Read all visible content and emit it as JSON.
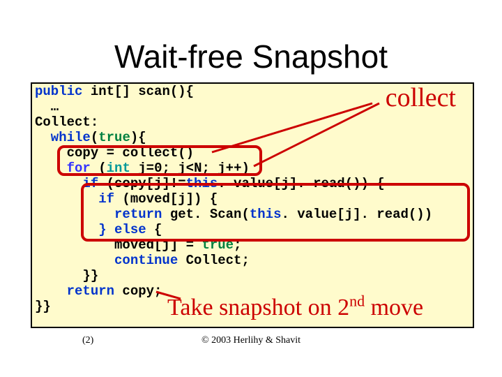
{
  "title": "Wait-free Snapshot",
  "code": {
    "l1a": "public",
    "l1b": " int[] scan(){",
    "l2": "  …",
    "l3": "Collect:",
    "l4a": "  while",
    "l4b": "(",
    "l4c": "true",
    "l4d": "){",
    "l5": "    copy = collect()",
    "l6a": "    for",
    "l6b": " (",
    "l6c": "int",
    "l6d": " j=0; j<N; j++)",
    "l7a": "      if",
    "l7b": " (copy[j]!=",
    "l7c": "this",
    "l7d": ". value[j]. read()) {",
    "l8a": "        if",
    "l8b": " (moved[j]) {",
    "l9a": "          return",
    "l9b": " get. Scan(",
    "l9c": "this",
    "l9d": ". value[j]. read())",
    "l10a": "        } else",
    "l10b": " {",
    "l11a": "          moved[j] = ",
    "l11b": "true",
    "l11c": ";",
    "l12a": "          continue",
    "l12b": " Collect;",
    "l13": "      }}",
    "l14a": "    return",
    "l14b": " copy;",
    "l15": "}}"
  },
  "callouts": {
    "collect": "collect",
    "snapshot_pre": "Take snapshot on 2",
    "snapshot_sup": "nd",
    "snapshot_post": " move"
  },
  "footer": {
    "slidenum": "(2)",
    "copyright": "© 2003 Herlihy & Shavit"
  }
}
